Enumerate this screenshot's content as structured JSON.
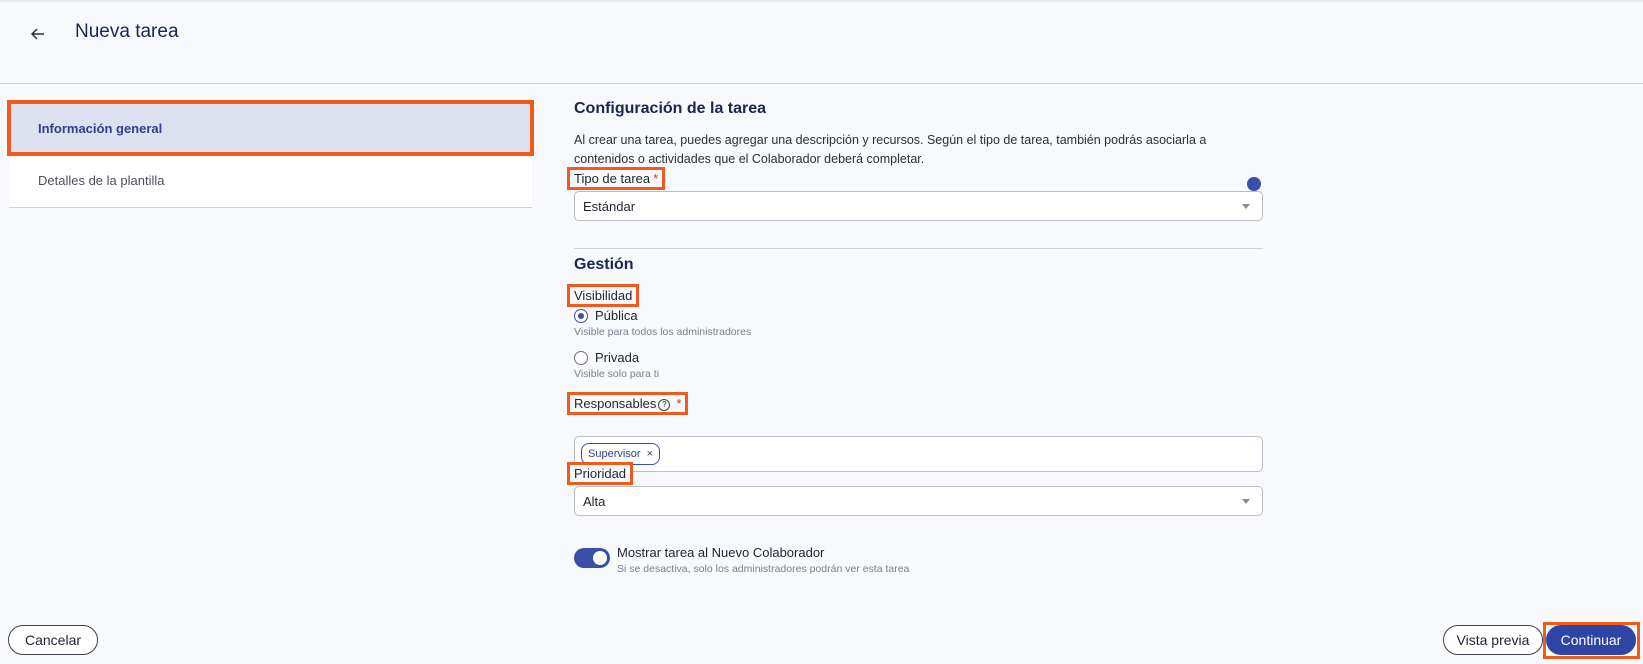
{
  "header": {
    "back_icon": "arrow-left-icon",
    "title": "Nueva tarea"
  },
  "nav": {
    "items": [
      {
        "label": "Información general",
        "active": true
      },
      {
        "label": "Detalles de la plantilla",
        "active": false
      }
    ]
  },
  "config": {
    "title": "Configuración de la tarea",
    "description": "Al crear una tarea, puedes agregar una descripción y recursos. Según el tipo de tarea, también podrás asociarla a contenidos o actividades que el Colaborador deberá completar.",
    "task_type_label": "Tipo de tarea",
    "required_mark": "*",
    "task_type_value": "Estándar"
  },
  "management": {
    "title": "Gestión",
    "visibility_label": "Visibilidad",
    "options": [
      {
        "label": "Pública",
        "hint": "Visible para todos los administradores",
        "checked": true
      },
      {
        "label": "Privada",
        "hint": "Visible solo para ti",
        "checked": false
      }
    ],
    "responsables_label": "Responsables",
    "help_glyph": "?",
    "responsables_chips": [
      {
        "label": "Supervisor",
        "remove": "×"
      }
    ],
    "priority_label": "Prioridad",
    "priority_value": "Alta",
    "toggle_label": "Mostrar tarea al Nuevo Colaborador",
    "toggle_hint": "Si se desactiva, solo los administradores podrán ver esta tarea",
    "toggle_on": true
  },
  "footer": {
    "cancel": "Cancelar",
    "preview": "Vista previa",
    "continue": "Continuar"
  },
  "colors": {
    "accent": "#2f45a6",
    "highlight": "#f15a1d",
    "title": "#1b2550"
  }
}
